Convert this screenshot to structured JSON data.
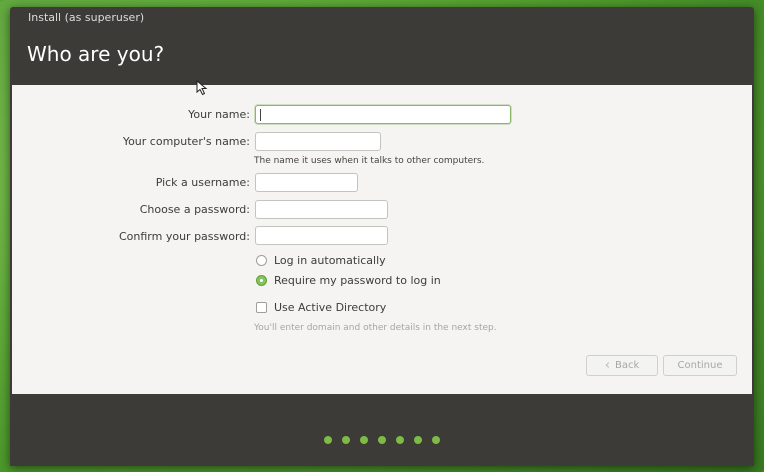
{
  "window": {
    "title": "Install (as superuser)"
  },
  "header": {
    "title": "Who are you?"
  },
  "form": {
    "your_name_label": "Your name:",
    "your_name_value": "",
    "computer_name_label": "Your computer's name:",
    "computer_name_value": "",
    "computer_name_hint": "The name it uses when it talks to other computers.",
    "username_label": "Pick a username:",
    "username_value": "",
    "password_label": "Choose a password:",
    "password_value": "",
    "confirm_password_label": "Confirm your password:",
    "confirm_password_value": ""
  },
  "login_options": {
    "auto_login_label": "Log in automatically",
    "auto_login_selected": false,
    "require_password_label": "Require my password to log in",
    "require_password_selected": true
  },
  "active_directory": {
    "label": "Use Active Directory",
    "checked": false,
    "hint": "You'll enter domain and other details in the next step."
  },
  "buttons": {
    "back_label": "Back",
    "continue_label": "Continue"
  },
  "progress": {
    "total_steps": 7
  },
  "colors": {
    "accent": "#87c25c",
    "header_bg": "#3c3b37",
    "content_bg": "#f5f4f2",
    "progress_dot": "#7dbb46"
  }
}
